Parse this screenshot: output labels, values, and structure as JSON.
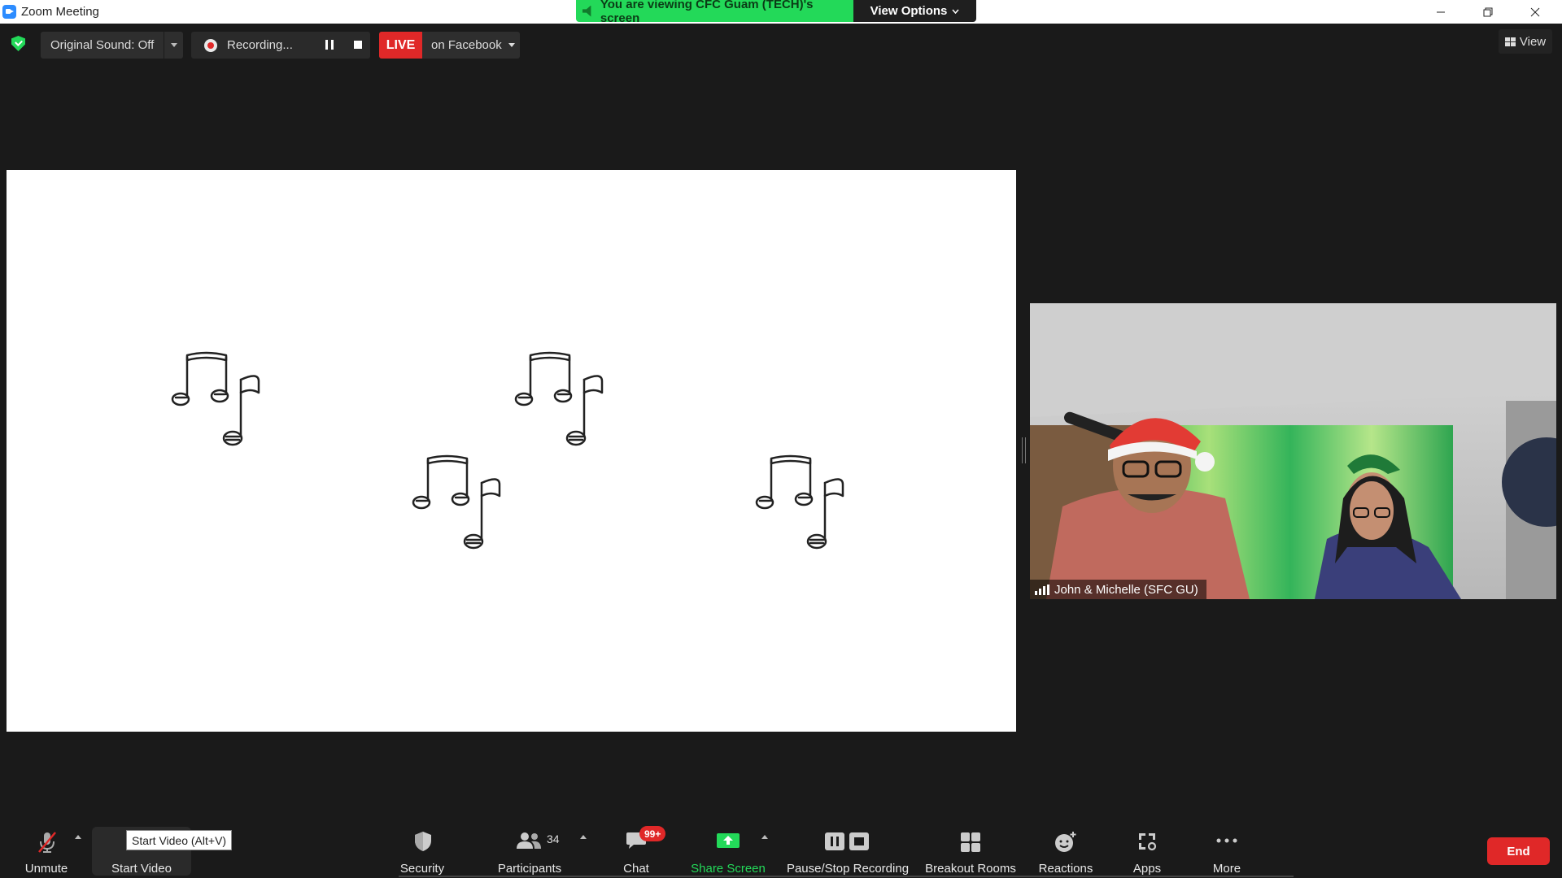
{
  "window": {
    "title": "Zoom Meeting",
    "controls": [
      "minimize-icon",
      "restore-icon",
      "close-icon"
    ]
  },
  "banner": {
    "viewing_text": "You are viewing CFC Guam (TECH)'s screen",
    "options_label": "View Options"
  },
  "top_controls": {
    "original_sound": "Original Sound: Off",
    "recording_label": "Recording...",
    "live_label": "LIVE",
    "live_target": "on Facebook",
    "view_label": "View"
  },
  "video": {
    "participant_name": "John & Michelle (SFC GU)"
  },
  "toolbar": {
    "unmute": "Unmute",
    "start_video": "Start Video",
    "tooltip": "Start Video (Alt+V)",
    "security": "Security",
    "participants": "Participants",
    "participants_count": "34",
    "chat": "Chat",
    "chat_badge": "99+",
    "share_screen": "Share Screen",
    "pause_stop_recording": "Pause/Stop Recording",
    "breakout_rooms": "Breakout Rooms",
    "reactions": "Reactions",
    "apps": "Apps",
    "more": "More",
    "end": "End"
  },
  "colors": {
    "accent_green": "#23d959",
    "live_red": "#e02828",
    "background": "#1a1a1a"
  }
}
